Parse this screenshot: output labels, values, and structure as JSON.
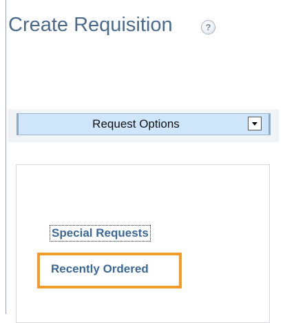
{
  "page": {
    "title": "Create Requisition",
    "help_icon": "help-icon",
    "help_symbol": "?"
  },
  "request_options": {
    "label": "Request Options",
    "dropdown_icon": "dropdown-arrow-icon"
  },
  "links": {
    "special_requests": "Special Requests",
    "recently_ordered": "Recently Ordered"
  },
  "colors": {
    "title": "#4a6a8c",
    "link": "#3b6796",
    "options_bar": "#cfe6fa",
    "highlight": "#f39a2a"
  }
}
